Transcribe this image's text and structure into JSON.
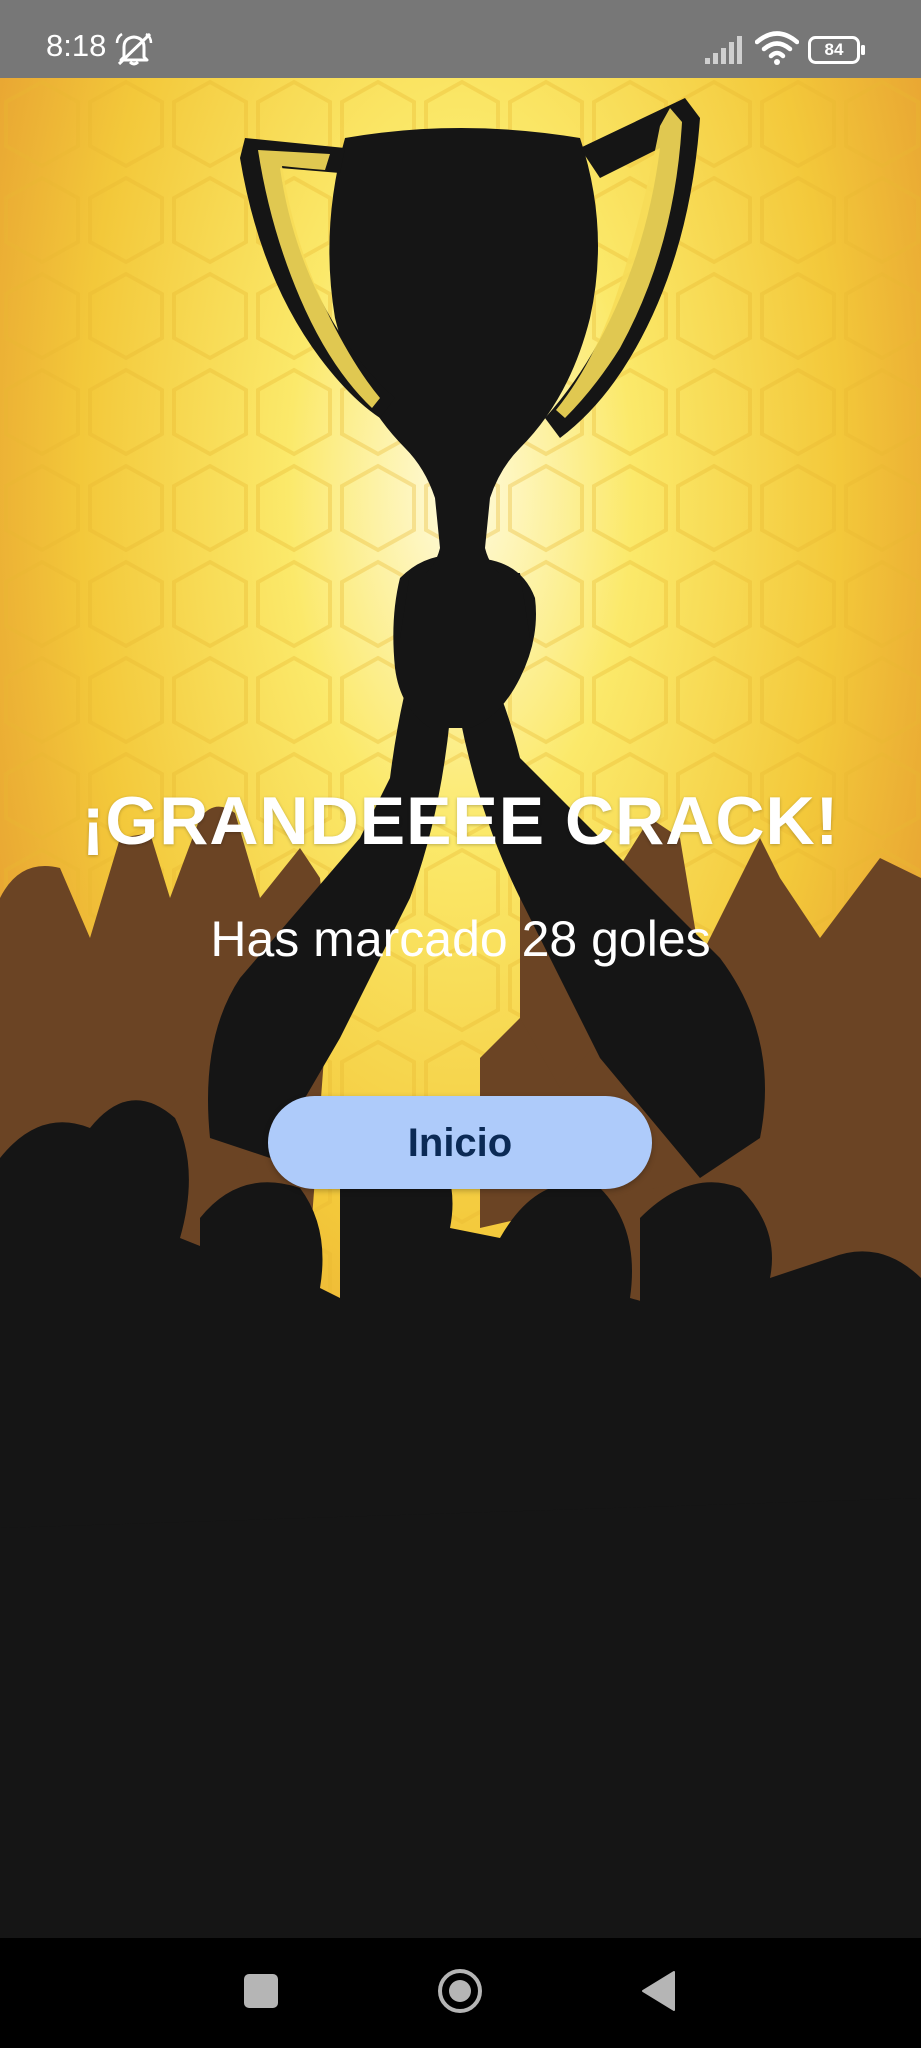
{
  "status_bar": {
    "time": "8:18",
    "battery_level": "84",
    "icons": [
      "notifications-off-icon",
      "signal-icon",
      "wifi-icon",
      "battery-icon"
    ]
  },
  "background": {
    "description_icon": "trophy-celebration-illustration",
    "colors": {
      "yellow": "#f7e04a",
      "orange": "#e8a23a",
      "silhouette": "#151515",
      "crowd_brown": "#6b4424"
    }
  },
  "result": {
    "headline": "¡GRANDEEEE CRACK!",
    "subtitle": "Has marcado 28 goles",
    "goals": 28
  },
  "actions": {
    "start_label": "Inicio",
    "button_color": "#aecbfa"
  },
  "nav_bar": {
    "icons": [
      "recents-icon",
      "home-icon",
      "back-icon"
    ]
  }
}
